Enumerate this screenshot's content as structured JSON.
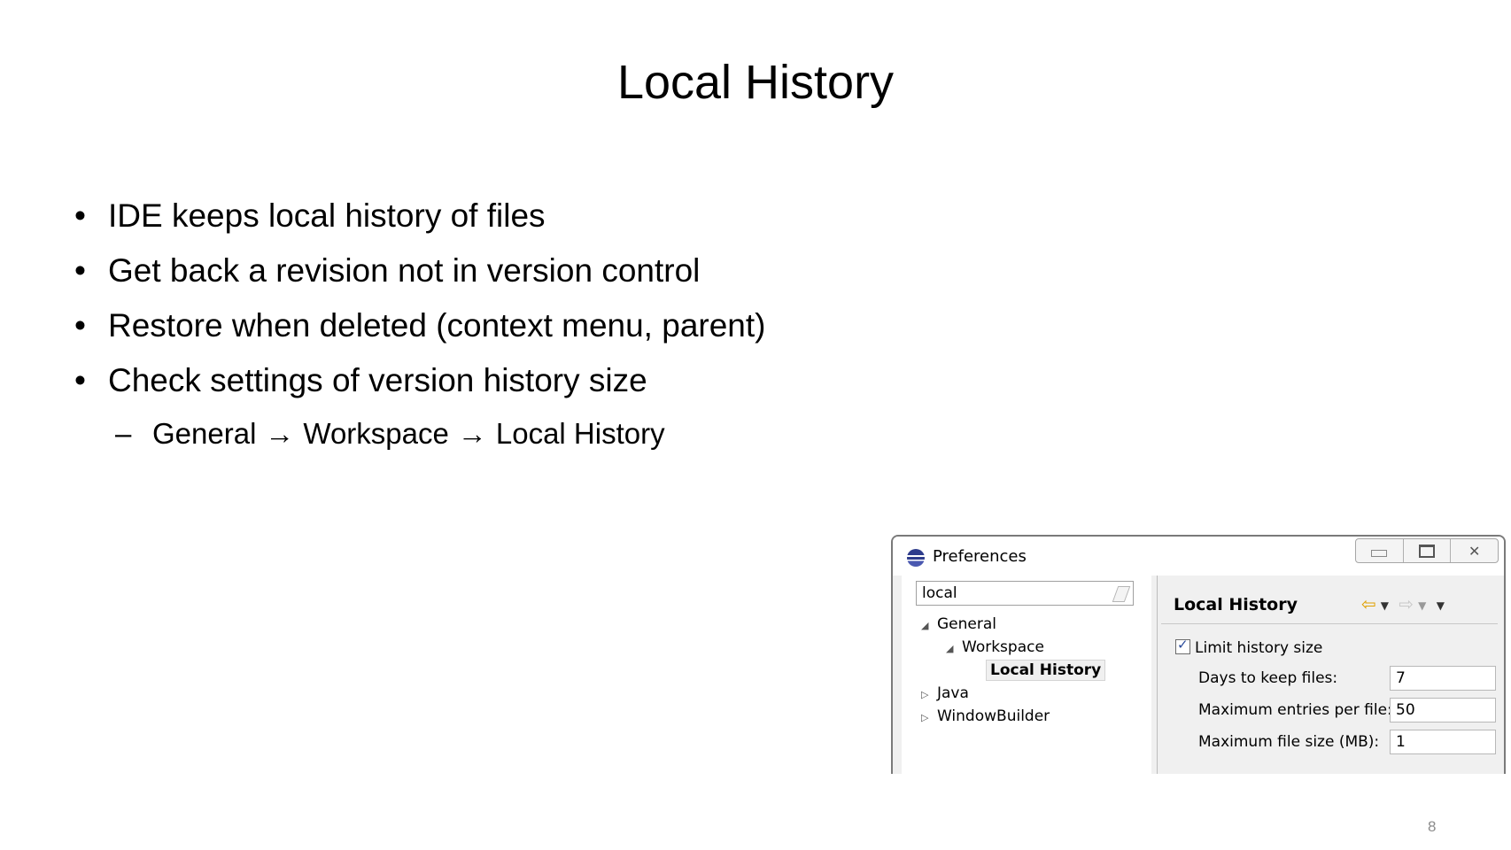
{
  "slide": {
    "title": "Local History",
    "bullets": [
      "IDE keeps local history of files",
      "Get back a revision not in version control",
      "Restore when deleted (context menu, parent)",
      "Check settings of version history size"
    ],
    "sub_bullet": {
      "dash": "–",
      "steps": [
        "General",
        "Workspace",
        "Local History"
      ],
      "arrow": "→"
    },
    "page_number": "8"
  },
  "preferences_window": {
    "title": "Preferences",
    "filter_value": "local",
    "tree": [
      "General",
      "Workspace",
      "Local History",
      "Java",
      "WindowBuilder"
    ],
    "page_title": "Local History",
    "limit_history_label": "Limit history size",
    "limit_history_checked": true,
    "fields": [
      {
        "label": "Days to keep files:",
        "value": "7"
      },
      {
        "label": "Maximum entries per file:",
        "value": "50"
      },
      {
        "label": "Maximum file size (MB):",
        "value": "1"
      }
    ],
    "icons": [
      "eclipse-icon",
      "minimize-icon",
      "maximize-icon",
      "close-icon",
      "clear-filter-icon",
      "back-arrow-icon",
      "forward-arrow-icon",
      "menu-dropdown-icon"
    ]
  }
}
